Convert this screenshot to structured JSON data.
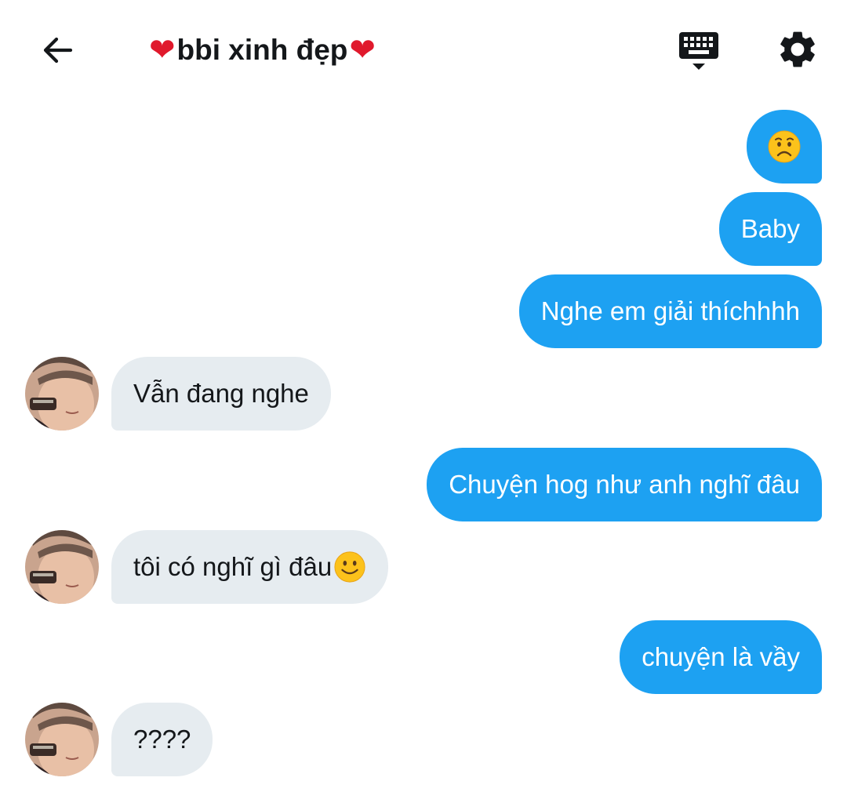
{
  "header": {
    "title_prefix_heart": "❤",
    "title": "bbi xinh đẹp",
    "title_suffix_heart": "❤",
    "icons": {
      "back": "arrow-left-icon",
      "keyboard": "keyboard-icon",
      "settings": "gear-icon"
    }
  },
  "colors": {
    "outgoing_bubble": "#1da1f2",
    "incoming_bubble": "#e6ecf0",
    "heart": "#e0192c"
  },
  "messages": [
    {
      "direction": "out",
      "emoji": "worried-face-emoji"
    },
    {
      "direction": "out",
      "text": "Baby"
    },
    {
      "direction": "out",
      "text": "Nghe em giải thíchhhh"
    },
    {
      "direction": "in",
      "text": "Vẫn đang nghe"
    },
    {
      "direction": "out",
      "text": "Chuyện hog như anh nghĩ đâu"
    },
    {
      "direction": "in",
      "text": "tôi có nghĩ gì đâu",
      "emoji": "slightly-smiling-face-emoji"
    },
    {
      "direction": "out",
      "text": "chuyện là vầy"
    },
    {
      "direction": "in",
      "text": "????"
    }
  ]
}
